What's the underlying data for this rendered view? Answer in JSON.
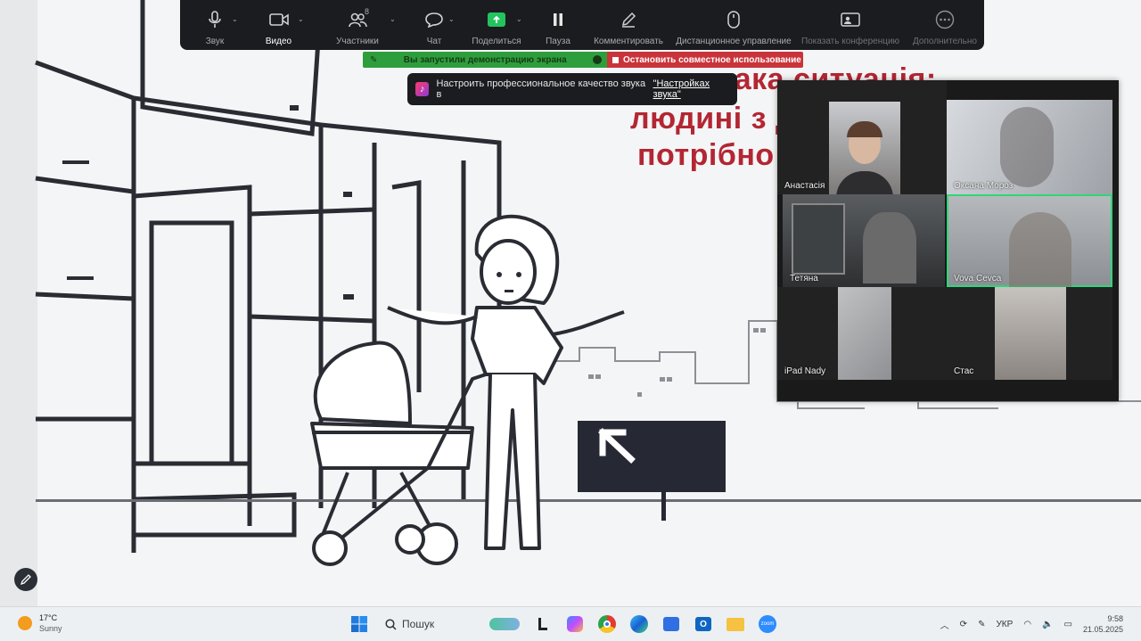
{
  "slide": {
    "lines": [
      "ж така ситуація:",
      "людині з д",
      "потрібно"
    ]
  },
  "toolbar": {
    "buttons": [
      {
        "label": "Звук",
        "icon": "microphone-icon"
      },
      {
        "label": "Видео",
        "icon": "video-camera-icon"
      },
      {
        "label": "Участники",
        "icon": "participants-icon",
        "count": "8"
      },
      {
        "label": "Чат",
        "icon": "chat-icon"
      },
      {
        "label": "Поделиться",
        "icon": "share-screen-icon"
      },
      {
        "label": "Пауза",
        "icon": "pause-icon"
      },
      {
        "label": "Комментировать",
        "icon": "pencil-icon"
      },
      {
        "label": "Дистанционное управление",
        "icon": "mouse-icon"
      },
      {
        "label": "Показать конференцию",
        "icon": "show-meeting-icon"
      },
      {
        "label": "Дополнительно",
        "icon": "more-icon"
      }
    ]
  },
  "share_bar": {
    "status": "Вы запустили демонстрацию экрана",
    "stop": "Остановить совместное использование",
    "status_color": "#2e9e3c",
    "stop_color": "#c9343b"
  },
  "audio_tip": {
    "text": "Настроить профессиональное качество звука в",
    "link": "\"Настройках звука\""
  },
  "gallery": {
    "participants": [
      {
        "name": "Анастасія"
      },
      {
        "name": "Оксана Мороз"
      },
      {
        "name": "Тетяна"
      },
      {
        "name": "Vova Cevca"
      },
      {
        "name": "iPad Nady"
      },
      {
        "name": "Стас"
      }
    ],
    "active_color": "#2ed67a"
  },
  "taskbar": {
    "weather": {
      "temp": "17°C",
      "condition": "Sunny"
    },
    "search_placeholder": "Пошук",
    "apps": [
      "start-icon",
      "search-icon",
      "taskview-icon",
      "files-icon",
      "copilot-icon",
      "chrome-icon",
      "edge-icon",
      "store-icon",
      "outlook-icon",
      "explorer-icon",
      "zoom-icon"
    ],
    "language": "УКР",
    "time": "9:58",
    "date": "21.05.2025"
  }
}
